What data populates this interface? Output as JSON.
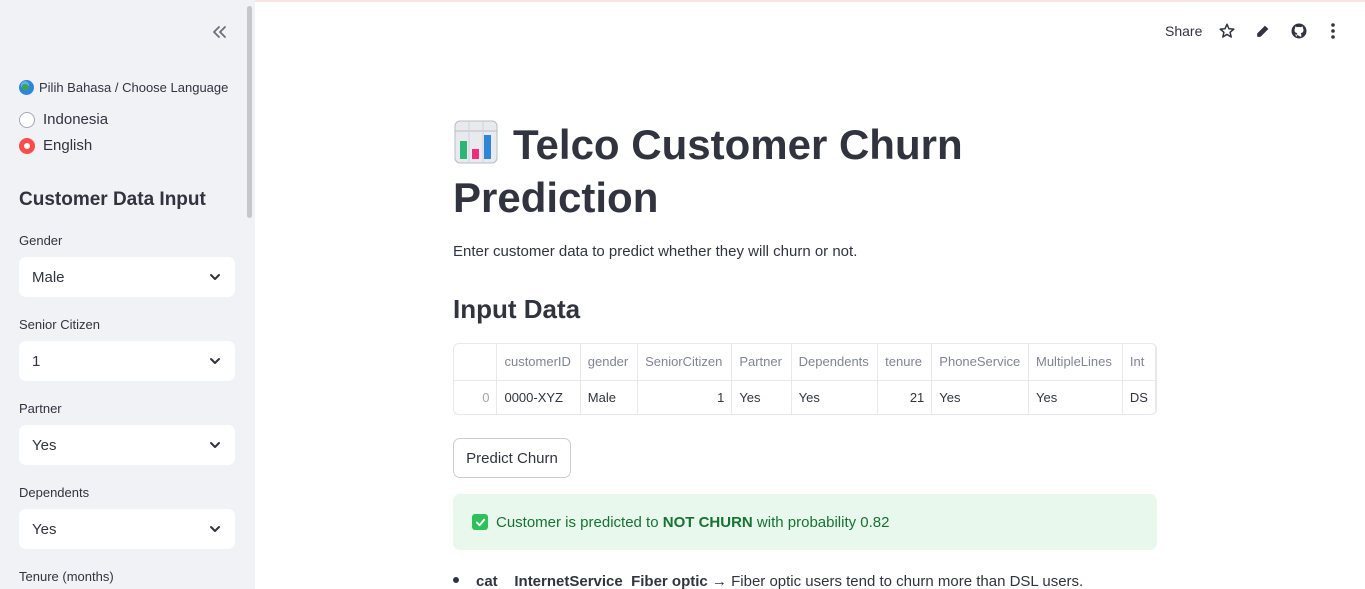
{
  "sidebar": {
    "language_label": "Pilih Bahasa / Choose Language",
    "language_options": [
      "Indonesia",
      "English"
    ],
    "language_selected": "English",
    "heading": "Customer Data Input",
    "fields": [
      {
        "label": "Gender",
        "value": "Male"
      },
      {
        "label": "Senior Citizen",
        "value": "1"
      },
      {
        "label": "Partner",
        "value": "Yes"
      },
      {
        "label": "Dependents",
        "value": "Yes"
      },
      {
        "label": "Tenure (months)",
        "value": ""
      }
    ]
  },
  "header": {
    "share_label": "Share"
  },
  "main": {
    "title": "Telco Customer Churn Prediction",
    "subtitle": "Enter customer data to predict whether they will churn or not.",
    "input_heading": "Input Data",
    "table": {
      "columns": [
        "",
        "customerID",
        "gender",
        "SeniorCitizen",
        "Partner",
        "Dependents",
        "tenure",
        "PhoneService",
        "MultipleLines",
        "Int"
      ],
      "rows": [
        [
          "0",
          "0000-XYZ",
          "Male",
          "1",
          "Yes",
          "Yes",
          "21",
          "Yes",
          "Yes",
          "DS"
        ]
      ]
    },
    "predict_button": "Predict Churn",
    "result": {
      "prefix": "Customer is predicted to ",
      "label": "NOT CHURN",
      "suffix": " with probability 0.82"
    },
    "explanation": {
      "part1": "cat",
      "part2": "InternetService",
      "part3": "Fiber optic",
      "text": " → Fiber optic users tend to churn more than DSL users."
    }
  },
  "colors": {
    "accent": "#ff4b4b",
    "sidebar_bg": "#f0f2f6",
    "success_bg": "#e8f8ed",
    "success_text": "#177233"
  }
}
